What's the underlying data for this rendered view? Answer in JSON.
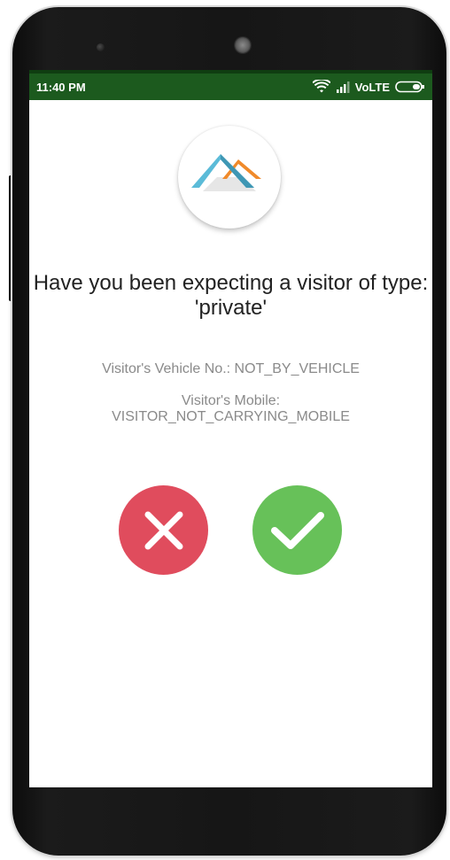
{
  "status_bar": {
    "time": "11:40 PM",
    "network": "VoLTE",
    "icons": [
      "wifi-icon",
      "signal-icon",
      "battery-icon"
    ],
    "color": "#1c5a1e"
  },
  "app": {
    "logo_icon": "house-roof-logo-icon",
    "logo_colors": [
      "#5bbbd8",
      "#f08a2a"
    ]
  },
  "prompt": {
    "title": "Have you been expecting a visitor of type: 'private'",
    "vehicle_label": "Visitor's Vehicle No.: NOT_BY_VEHICLE",
    "mobile_label": "Visitor's Mobile:",
    "mobile_value": "VISITOR_NOT_CARRYING_MOBILE"
  },
  "actions": {
    "reject_icon": "close-icon",
    "reject_color": "#e04c5d",
    "accept_icon": "checkmark-icon",
    "accept_color": "#67c159"
  }
}
